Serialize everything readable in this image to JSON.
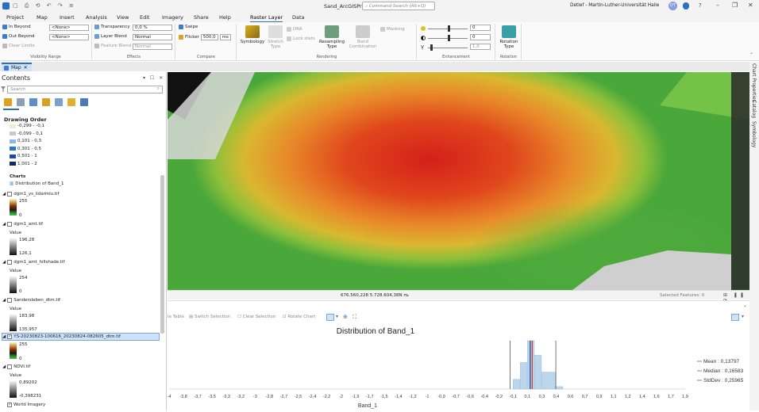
{
  "titlebar": {
    "title": "Sand_ArcGISPro",
    "search_placeholder": "Command Search (Alt+Q)",
    "user": "Detlef - Martin-Luther-Universität Halle",
    "avatar": "DT",
    "help": "?"
  },
  "menu": {
    "tabs": [
      "Project",
      "Map",
      "Insert",
      "Analysis",
      "View",
      "Edit",
      "Imagery",
      "Share",
      "Help",
      "Raster Layer",
      "Data"
    ],
    "active": "Raster Layer"
  },
  "ribbon": {
    "visibility": {
      "in_beyond": "In Beyond",
      "out_beyond": "Out Beyond",
      "clear_limits": "Clear Limits",
      "in_value": "<None>",
      "out_value": "<None>",
      "label": "Visibility Range"
    },
    "effects": {
      "transparency": "Transparency",
      "transparency_value": "0,0 %",
      "layer_blend": "Layer Blend",
      "layer_blend_value": "Normal",
      "feature_blend": "Feature Blend",
      "feature_blend_value": "Normal",
      "label": "Effects"
    },
    "compare": {
      "swipe": "Swipe",
      "flicker": "Flicker",
      "flicker_value": "500,0",
      "flicker_unit": "ms",
      "label": "Compare"
    },
    "rendering": {
      "symbology": "Symbology",
      "stretch": "Stretch Type",
      "dra": "DRA",
      "lock_stats": "Lock stats",
      "resampling": "Resampling Type",
      "band_combination": "Band Combination",
      "masking": "Masking",
      "label": "Rendering"
    },
    "enhancement": {
      "brightness": "0",
      "contrast": "0",
      "gamma": "1,0",
      "label": "Enhancement"
    },
    "rotation": {
      "button": "Rotation Type",
      "label": "Rotation"
    }
  },
  "doc_tab": {
    "label": "Map"
  },
  "contents": {
    "title": "Contents",
    "search_placeholder": "Search",
    "drawing_order": "Drawing Order",
    "legend": [
      "-0,299 - -0,1",
      "-0,099 - 0,1",
      "0,101 - 0,3",
      "0,301 - 0,5",
      "0,501 - 1",
      "1,001 - 2"
    ],
    "legend_colors": [
      "#e6f2c8",
      "#c8c8c8",
      "#8fb8e0",
      "#2a78c0",
      "#1a4fa0",
      "#102a70"
    ],
    "charts_label": "Charts",
    "chart_item": "Distribution of Band_1",
    "layers": [
      {
        "name": "dgm1_ys_lidarmlu.tif",
        "hi": "255",
        "lo": "0",
        "value_label": ""
      },
      {
        "name": "dgm1_amt.tif",
        "value_label": "Value",
        "hi": "196,28",
        "lo": "126,1"
      },
      {
        "name": "dgm1_amt_hillshade.tif",
        "value_label": "Value",
        "hi": "254",
        "lo": "0"
      },
      {
        "name": "Sandersleben_dtm.tif",
        "value_label": "Value",
        "hi": "183,98",
        "lo": "135,957"
      },
      {
        "name": "YS-20230823-100616_20230824-082605_dtm.tif",
        "value_label": "",
        "hi": "255",
        "lo": "0"
      },
      {
        "name": "NDVI.tif",
        "value_label": "Value",
        "hi": "0,89202",
        "lo": "-0,398231"
      },
      {
        "name": "World Imagery"
      }
    ]
  },
  "map_status": {
    "scale": "676.560,228 5.728.604,38N m",
    "selected": "Selected Features: 0"
  },
  "chart_toolbar": {
    "table": "le Table",
    "switch": "Switch Selection",
    "clear": "Clear Selection",
    "rotate": "Rotate Chart"
  },
  "right_panel": {
    "items": [
      "Chart Properties",
      "Catalog",
      "Symbology"
    ]
  },
  "chart_data": {
    "type": "bar",
    "title": "Distribution of Band_1",
    "xlabel": "Band_1",
    "x_ticks": [
      "-4",
      "-3,8",
      "-3,7",
      "-3,5",
      "-3,3",
      "-3,2",
      "-3",
      "-2,8",
      "-2,7",
      "-2,5",
      "-2,4",
      "-2,2",
      "-2",
      "-1,9",
      "-1,7",
      "-1,5",
      "-1,4",
      "-1,2",
      "-1",
      "-0,9",
      "-0,7",
      "-0,6",
      "-0,4",
      "-0,2",
      "-0,1",
      "0,1",
      "0,3",
      "0,4",
      "0,6",
      "0,7",
      "0,9",
      "1,1",
      "1,2",
      "1,4",
      "1,6",
      "1,7",
      "1,9"
    ],
    "bins": [
      {
        "x0": -0.1,
        "x1": 0.0,
        "value": 0.2
      },
      {
        "x0": 0.0,
        "x1": 0.1,
        "value": 0.55
      },
      {
        "x0": 0.1,
        "x1": 0.2,
        "value": 1.0
      },
      {
        "x0": 0.2,
        "x1": 0.3,
        "value": 0.7
      },
      {
        "x0": 0.3,
        "x1": 0.4,
        "value": 0.35
      },
      {
        "x0": 0.4,
        "x1": 0.5,
        "value": 0.05
      }
    ],
    "xlim": [
      -4,
      2.0
    ],
    "stats": {
      "mean": 0.13797,
      "median": 0.16583,
      "stddev": 0.25965
    },
    "legend": [
      "Mean : 0,13797",
      "Median : 0,16583",
      "StdDev : 0,25965"
    ],
    "colors": {
      "bar": "#bcd6ec",
      "mean": "#1f3a93",
      "median": "#d23a2a",
      "stddev": "#555555"
    }
  }
}
